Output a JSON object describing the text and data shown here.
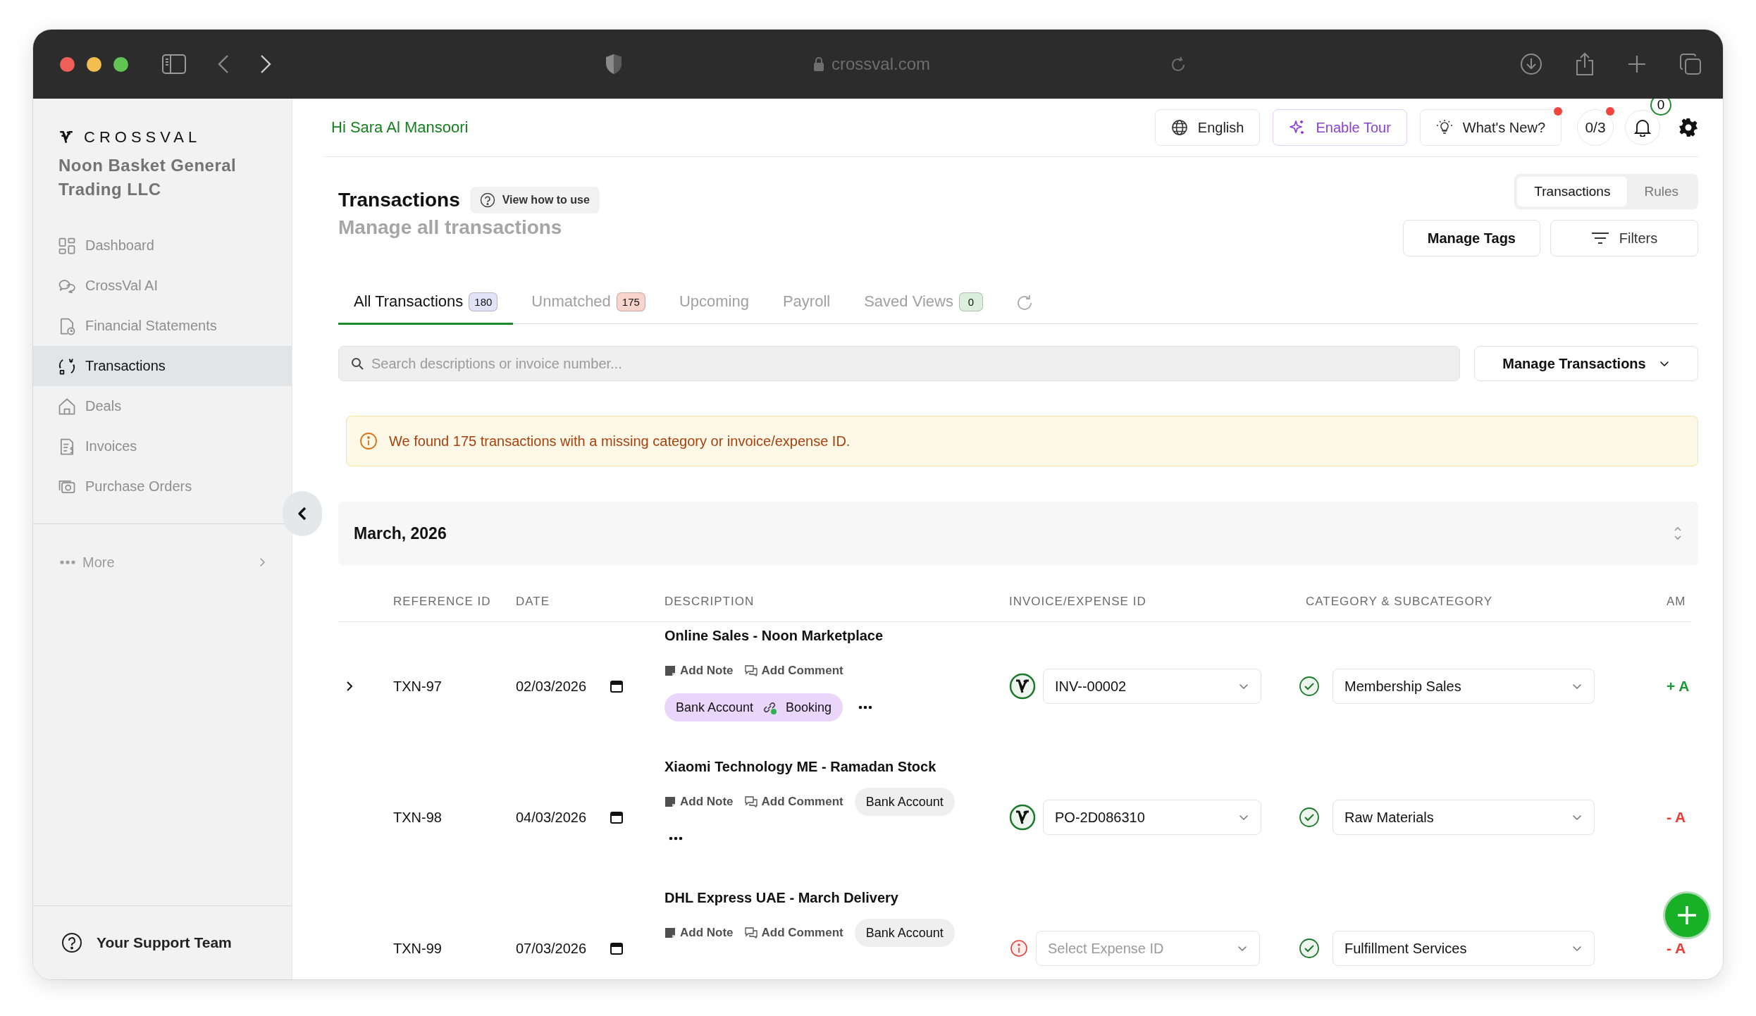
{
  "browser": {
    "url": "crossval.com"
  },
  "sidebar": {
    "brand": "CROSSVAL",
    "company": "Noon Basket General Trading LLC",
    "items": [
      {
        "label": "Dashboard",
        "selected": false
      },
      {
        "label": "CrossVal AI",
        "selected": false
      },
      {
        "label": "Financial Statements",
        "selected": false
      },
      {
        "label": "Transactions",
        "selected": true
      },
      {
        "label": "Deals",
        "selected": false
      },
      {
        "label": "Invoices",
        "selected": false
      },
      {
        "label": "Purchase Orders",
        "selected": false
      }
    ],
    "more": "More",
    "support": "Your Support Team"
  },
  "topbar": {
    "greeting": "Hi Sara Al Mansoori",
    "language": "English",
    "tour": "Enable Tour",
    "whats_new": "What's New?",
    "whats_new_unread": true,
    "progress": "0/3",
    "progress_unread": true,
    "notifications": "0"
  },
  "header": {
    "title": "Transactions",
    "help": "View how to use",
    "subtitle": "Manage all transactions",
    "views": [
      {
        "label": "Transactions",
        "selected": true
      },
      {
        "label": "Rules",
        "selected": false
      }
    ],
    "manage_tags": "Manage Tags",
    "filters": "Filters"
  },
  "tabs": [
    {
      "label": "All Transactions",
      "count": "180",
      "color": "#e4e2f7",
      "selected": true
    },
    {
      "label": "Unmatched",
      "count": "175",
      "color": "#f9d4cc",
      "selected": false
    },
    {
      "label": "Upcoming",
      "selected": false
    },
    {
      "label": "Payroll",
      "selected": false
    },
    {
      "label": "Saved Views",
      "count": "0",
      "color": "#dcefdc",
      "selected": false
    }
  ],
  "search": {
    "placeholder": "Search descriptions or invoice number..."
  },
  "manage_transactions": "Manage Transactions",
  "alert": "We found 175 transactions with a missing category or invoice/expense ID.",
  "group": {
    "month": "March, 2026"
  },
  "table": {
    "columns": [
      "REFERENCE ID",
      "DATE",
      "DESCRIPTION",
      "INVOICE/EXPENSE ID",
      "CATEGORY & SUBCATEGORY",
      "AM"
    ],
    "rows": [
      {
        "expandable": true,
        "reference": "TXN-97",
        "date": "02/03/2026",
        "description": "Online Sales - Noon Marketplace",
        "note": "Add Note",
        "comment": "Add Comment",
        "linked_account": "Bank Account",
        "linked_booking": "Booking",
        "more": true,
        "invoice_matched": true,
        "invoice": "INV--00002",
        "category_verified": true,
        "category": "Membership Sales",
        "kind": "credit",
        "amount": "+ A"
      },
      {
        "expandable": false,
        "reference": "TXN-98",
        "date": "04/03/2026",
        "description": "Xiaomi Technology ME - Ramadan Stock",
        "note": "Add Note",
        "comment": "Add Comment",
        "account": "Bank Account",
        "more": true,
        "invoice_matched": true,
        "invoice": "PO-2D086310",
        "category_verified": true,
        "category": "Raw Materials",
        "kind": "debit",
        "amount": "- A"
      },
      {
        "expandable": false,
        "reference": "TXN-99",
        "date": "07/03/2026",
        "description": "DHL Express UAE - March Delivery",
        "note": "Add Note",
        "comment": "Add Comment",
        "account": "Bank Account",
        "more": false,
        "invoice_matched": false,
        "invoice_placeholder": "Select Expense ID",
        "category_verified": true,
        "category": "Fulfillment Services",
        "kind": "debit",
        "amount": "- A"
      }
    ]
  }
}
